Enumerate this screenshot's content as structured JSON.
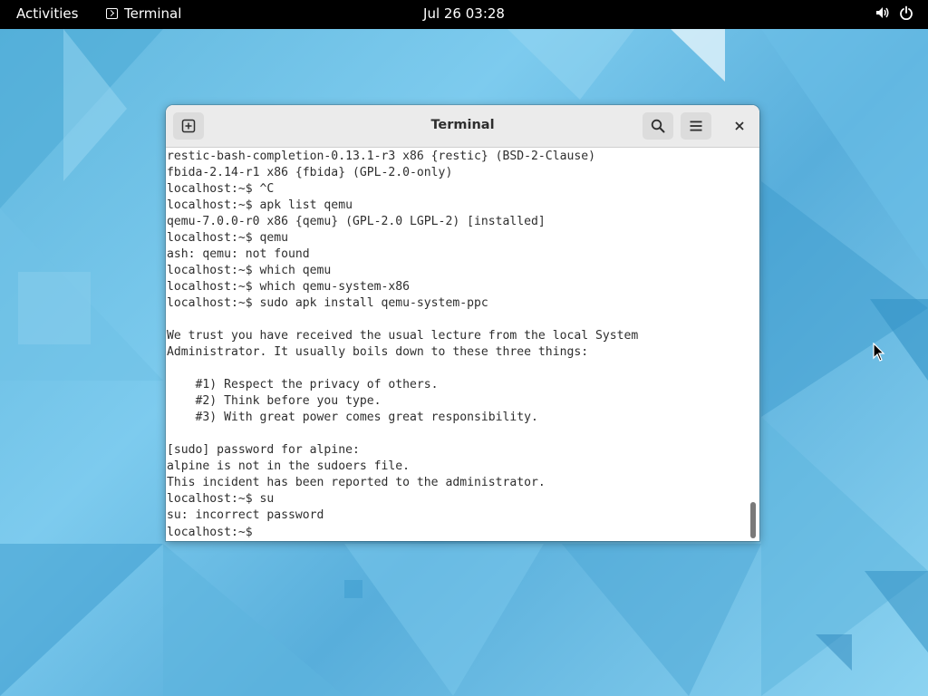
{
  "topbar": {
    "activities": "Activities",
    "app_name": "Terminal",
    "clock": "Jul 26  03:28"
  },
  "window": {
    "title": "Terminal",
    "lines": [
      "restic-bash-completion-0.13.1-r3 x86 {restic} (BSD-2-Clause)",
      "fbida-2.14-r1 x86 {fbida} (GPL-2.0-only)",
      "localhost:~$ ^C",
      "localhost:~$ apk list qemu",
      "qemu-7.0.0-r0 x86 {qemu} (GPL-2.0 LGPL-2) [installed]",
      "localhost:~$ qemu",
      "ash: qemu: not found",
      "localhost:~$ which qemu",
      "localhost:~$ which qemu-system-x86",
      "localhost:~$ sudo apk install qemu-system-ppc",
      "",
      "We trust you have received the usual lecture from the local System",
      "Administrator. It usually boils down to these three things:",
      "",
      "    #1) Respect the privacy of others.",
      "    #2) Think before you type.",
      "    #3) With great power comes great responsibility.",
      "",
      "[sudo] password for alpine:",
      "alpine is not in the sudoers file.",
      "This incident has been reported to the administrator.",
      "localhost:~$ su",
      "su: incorrect password"
    ],
    "prompt": "localhost:~$ "
  },
  "icons": {
    "app": "terminal-icon",
    "volume": "volume-icon",
    "power": "power-icon",
    "new_tab": "new-tab-icon",
    "search": "search-icon",
    "menu": "hamburger-menu-icon",
    "close": "close-icon",
    "pointer": "mouse-pointer-icon"
  }
}
